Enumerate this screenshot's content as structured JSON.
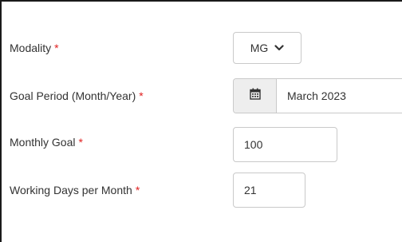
{
  "form": {
    "modality": {
      "label": "Modality",
      "required_mark": "*",
      "selected": "MG",
      "icon": "chevron-down-icon"
    },
    "goal_period": {
      "label": "Goal Period (Month/Year)",
      "required_mark": "*",
      "value": "March 2023",
      "icon": "calendar-icon"
    },
    "monthly_goal": {
      "label": "Monthly Goal",
      "required_mark": "*",
      "value": "100"
    },
    "working_days": {
      "label": "Working Days per Month",
      "required_mark": "*",
      "value": "21"
    }
  },
  "colors": {
    "required": "#e02020",
    "border": "#c9c9c9",
    "addon_bg": "#eeeeee"
  }
}
